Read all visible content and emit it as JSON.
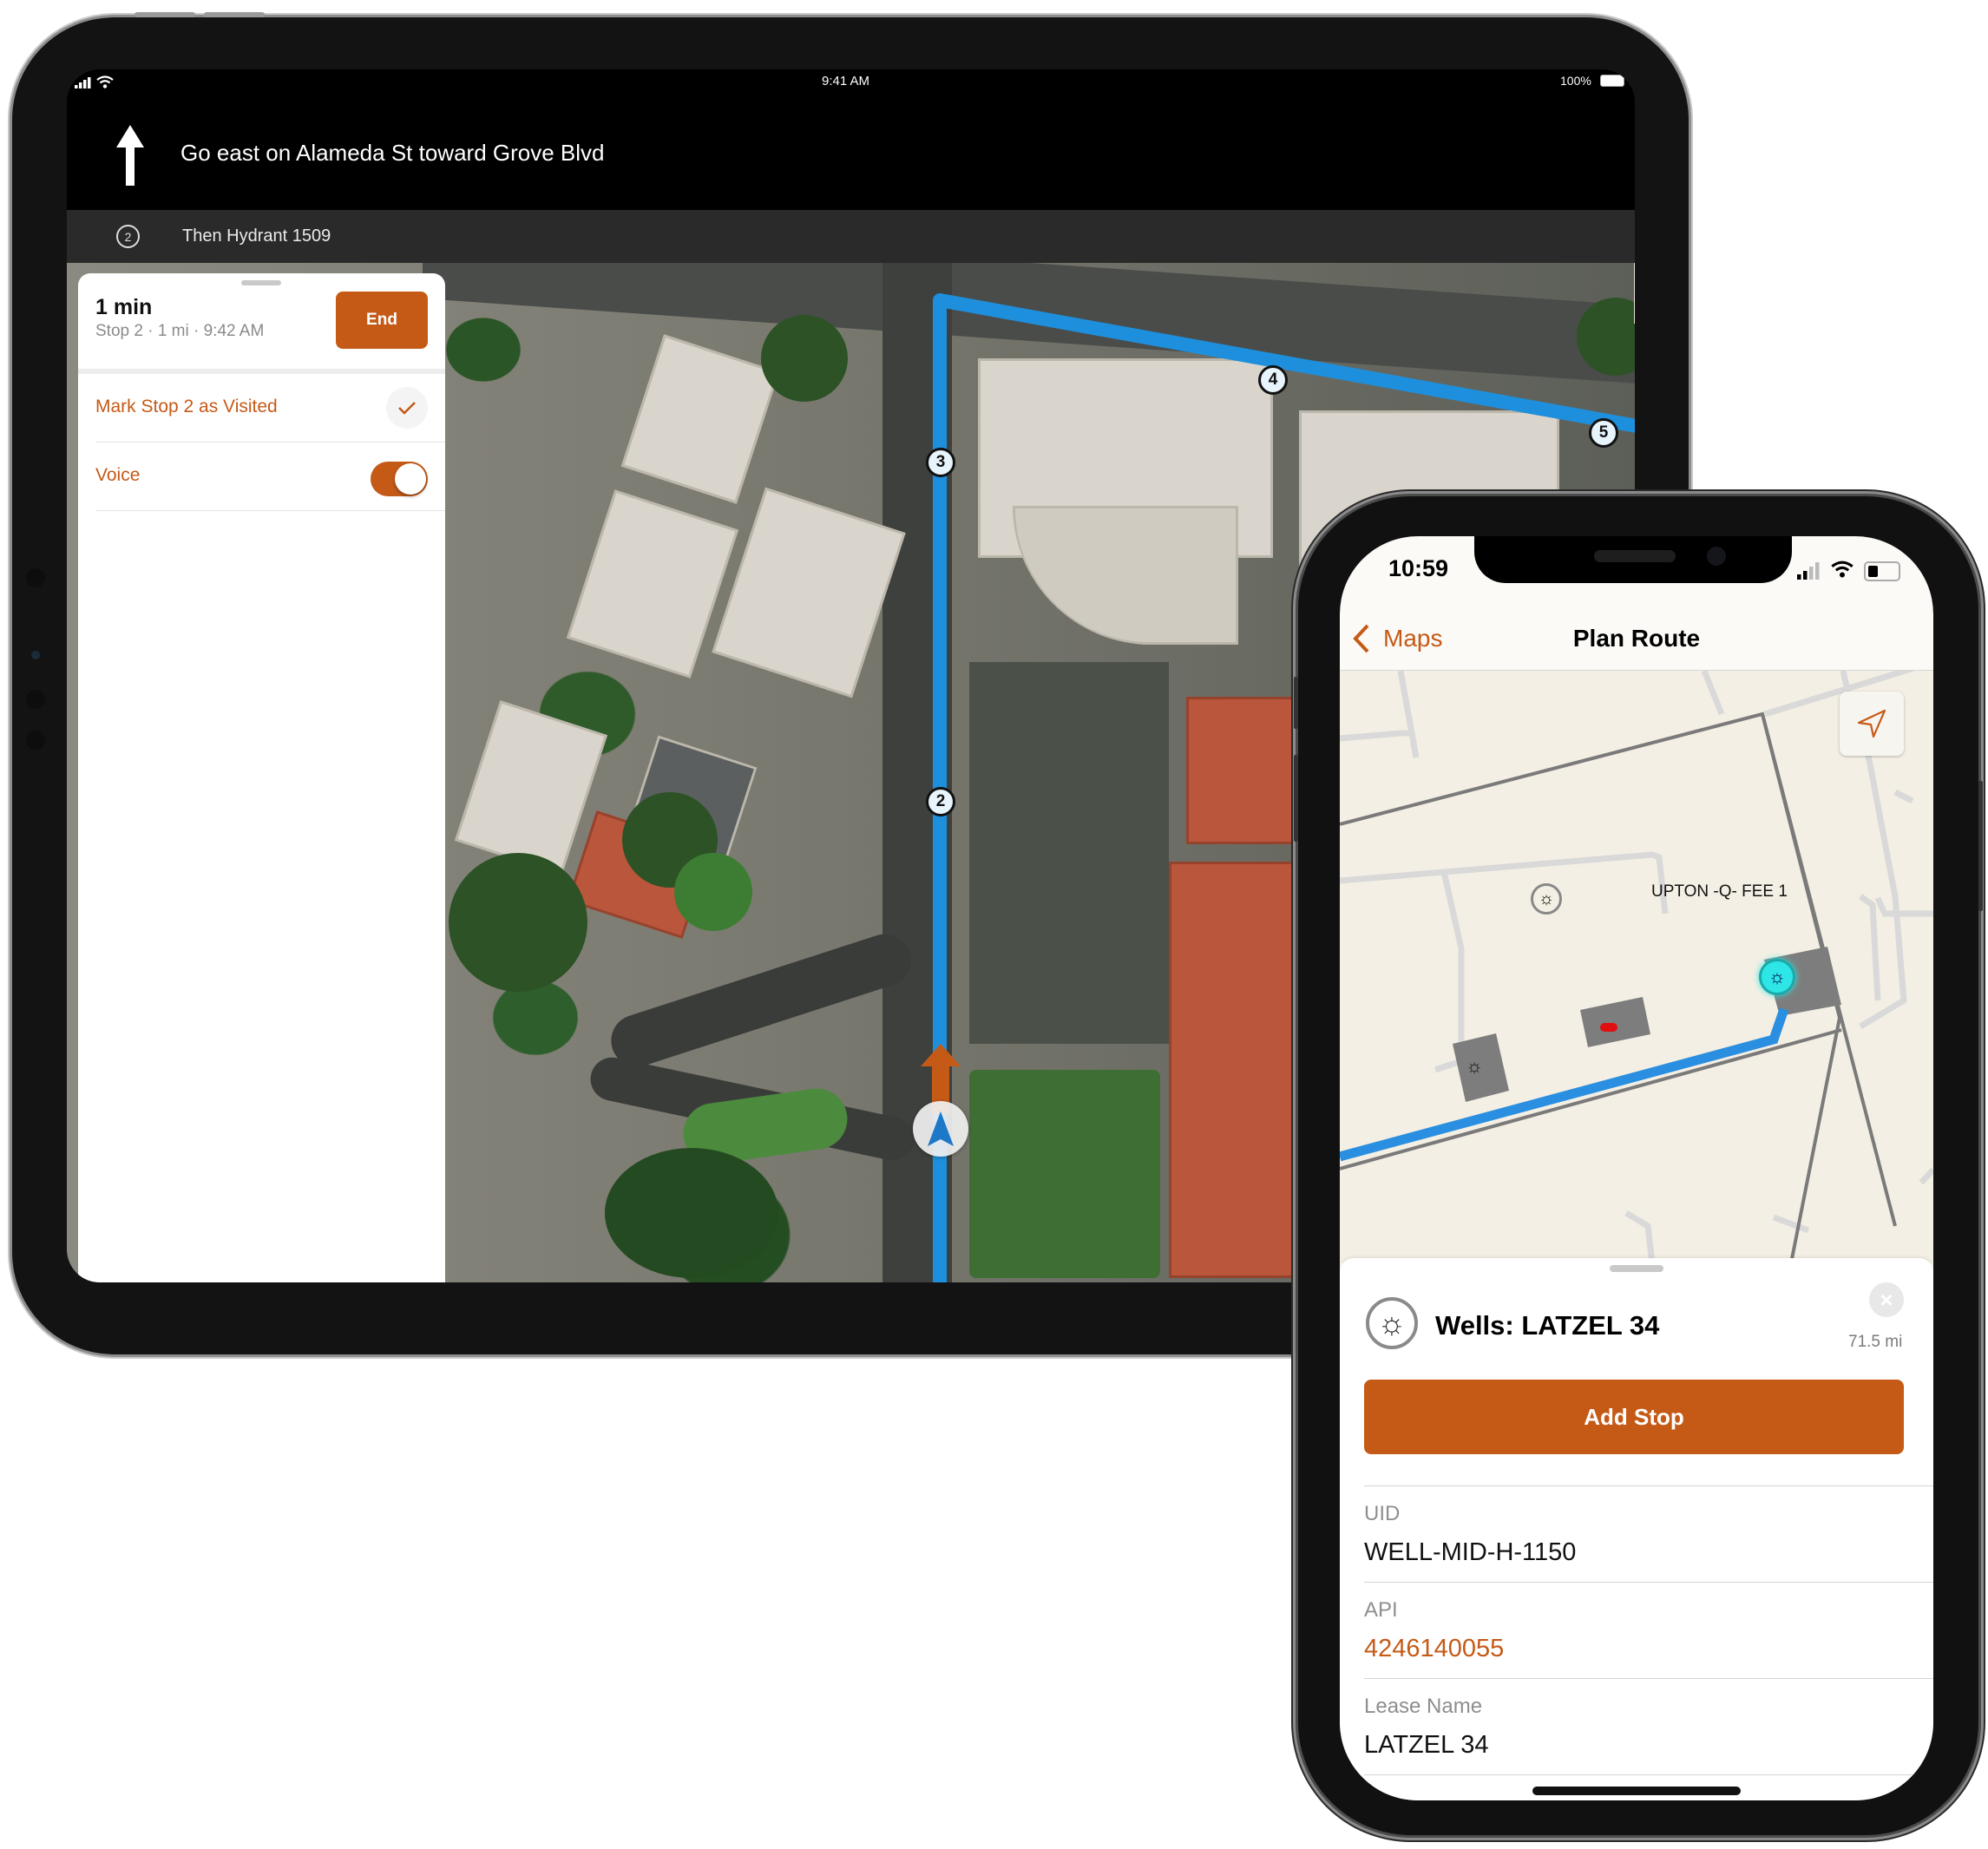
{
  "tablet": {
    "status_bar": {
      "time": "9:41 AM",
      "battery": "100%",
      "signal_icon": "cellular-signal-icon",
      "wifi_icon": "wifi-icon",
      "battery_icon": "battery-full-icon"
    },
    "instruction": {
      "icon": "arrow-up-icon",
      "text": "Go east on Alameda St toward Grove Blvd"
    },
    "next_step": {
      "number": "2",
      "text": "Then Hydrant 1509"
    },
    "panel": {
      "eta": "1 min",
      "summary": "Stop 2  · 1 mi · 9:42 AM",
      "end_label": "End",
      "rows": [
        {
          "label": "Mark Stop 2 as Visited",
          "control": "checkmark-button"
        },
        {
          "label": "Voice",
          "control": "toggle",
          "on": true
        }
      ]
    },
    "map": {
      "route_color": "#1e8fdc",
      "stops": [
        "3",
        "2",
        "4",
        "5"
      ],
      "heading_arrow_color": "#c55a17",
      "location_puck_color": "#1e78c8"
    }
  },
  "phone": {
    "status_bar": {
      "time": "10:59",
      "signal_icon": "cellular-signal-icon",
      "wifi_icon": "wifi-icon",
      "battery_icon": "battery-low-icon"
    },
    "nav": {
      "back_label": "Maps",
      "title": "Plan Route"
    },
    "map": {
      "well_label": "UPTON -Q- FEE 1",
      "route_color": "#2a8fe0",
      "selected_color": "#2ee6e6"
    },
    "card": {
      "title": "Wells: LATZEL 34",
      "distance": "71.5 mi",
      "add_stop_label": "Add Stop",
      "fields": [
        {
          "label": "UID",
          "value": "WELL-MID-H-1150",
          "link": false
        },
        {
          "label": "API",
          "value": "4246140055",
          "link": true
        },
        {
          "label": "Lease Name",
          "value": "LATZEL 34",
          "link": false
        }
      ]
    }
  },
  "colors": {
    "accent": "#c55a17"
  }
}
